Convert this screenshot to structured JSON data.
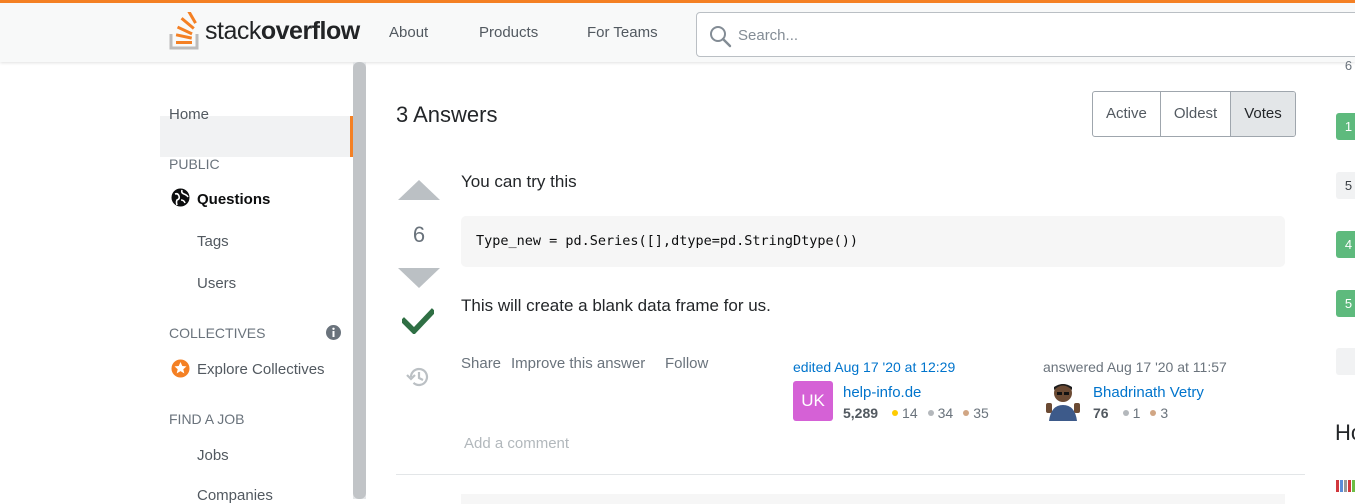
{
  "header": {
    "logo_regular": "stack",
    "logo_bold": "overflow",
    "nav": [
      "About",
      "Products",
      "For Teams"
    ],
    "search_placeholder": "Search..."
  },
  "sidebar": {
    "home": "Home",
    "public_heading": "PUBLIC",
    "questions": "Questions",
    "tags": "Tags",
    "users": "Users",
    "collectives_heading": "COLLECTIVES",
    "explore_collectives": "Explore Collectives",
    "find_job_heading": "FIND A JOB",
    "jobs": "Jobs",
    "companies": "Companies"
  },
  "answers": {
    "title": "3 Answers",
    "sort_tabs": [
      "Active",
      "Oldest",
      "Votes"
    ],
    "selected_sort": "Votes"
  },
  "answer": {
    "vote_count": "6",
    "accepted": true,
    "intro": "You can try this",
    "code": "Type_new = pd.Series([],dtype=pd.StringDtype())",
    "outro": "This will create a blank data frame for us.",
    "menu": [
      "Share",
      "Improve this answer",
      "Follow"
    ],
    "edited": {
      "label": "edited Aug 17 '20 at 12:29",
      "avatar_text": "UK",
      "user": "help-info.de",
      "reputation": "5,289",
      "gold": "14",
      "silver": "34",
      "bronze": "35"
    },
    "answered": {
      "label": "answered Aug 17 '20 at 11:57",
      "user": "Bhadrinath Vetry",
      "reputation": "76",
      "silver": "1",
      "bronze": "3"
    },
    "add_comment": "Add a comment"
  },
  "right_sidebar": {
    "counts": [
      "6",
      "1",
      "5",
      "4",
      "5",
      ""
    ],
    "heading_fragment": "Ho"
  },
  "colors": {
    "accent": "#f48024",
    "link": "#0074cc",
    "accepted": "#2f6f44",
    "answer_count_green": "#5eba7d"
  }
}
